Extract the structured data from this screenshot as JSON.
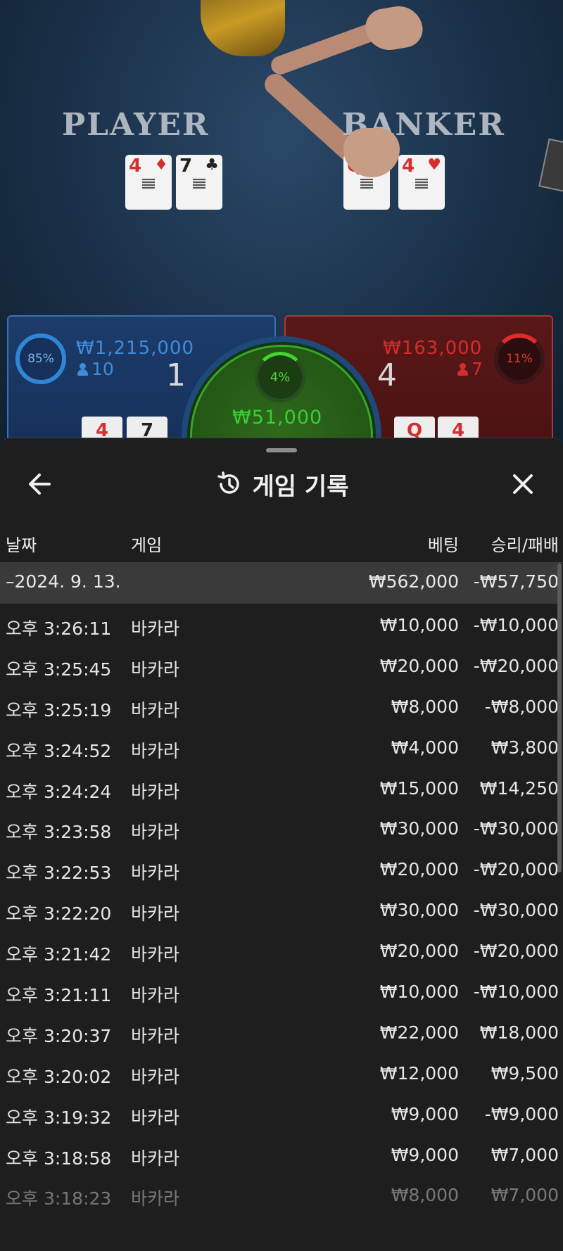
{
  "game": {
    "player_label": "PLAYER",
    "banker_label": "BANKER",
    "player_cards": [
      {
        "rank": "4",
        "suit": "♦"
      },
      {
        "rank": "7",
        "suit": "♣"
      }
    ],
    "banker_cards": [
      {
        "rank": "Q",
        "suit": "♥"
      },
      {
        "rank": "4",
        "suit": "♥"
      }
    ],
    "player": {
      "percent": "85%",
      "amount": "₩1,215,000",
      "count": "10",
      "score": "1"
    },
    "banker": {
      "percent": "11%",
      "amount": "₩163,000",
      "count": "7",
      "score": "4"
    },
    "tie": {
      "percent": "4%",
      "amount": "₩51,000"
    },
    "player_mini_cards": [
      "4",
      "7"
    ],
    "banker_mini_cards": [
      "Q",
      "4"
    ],
    "colors": {
      "player": "#3d8ce0",
      "banker": "#d82b2b",
      "tie": "#37d033"
    }
  },
  "sheet": {
    "title": "게임 기록",
    "back_icon": "arrow-left-icon",
    "history_icon": "history-icon",
    "close_icon": "close-icon",
    "columns": {
      "date": "날짜",
      "game": "게임",
      "bet": "베팅",
      "result": "승리/패배"
    },
    "day": {
      "date": "–2024. 9. 13.",
      "bet": "₩562,000",
      "result": "-₩57,750"
    },
    "rows": [
      {
        "time": "오후 3:26:11",
        "game": "바카라",
        "bet": "₩10,000",
        "result": "-₩10,000"
      },
      {
        "time": "오후 3:25:45",
        "game": "바카라",
        "bet": "₩20,000",
        "result": "-₩20,000"
      },
      {
        "time": "오후 3:25:19",
        "game": "바카라",
        "bet": "₩8,000",
        "result": "-₩8,000"
      },
      {
        "time": "오후 3:24:52",
        "game": "바카라",
        "bet": "₩4,000",
        "result": "₩3,800"
      },
      {
        "time": "오후 3:24:24",
        "game": "바카라",
        "bet": "₩15,000",
        "result": "₩14,250"
      },
      {
        "time": "오후 3:23:58",
        "game": "바카라",
        "bet": "₩30,000",
        "result": "-₩30,000"
      },
      {
        "time": "오후 3:22:53",
        "game": "바카라",
        "bet": "₩20,000",
        "result": "-₩20,000"
      },
      {
        "time": "오후 3:22:20",
        "game": "바카라",
        "bet": "₩30,000",
        "result": "-₩30,000"
      },
      {
        "time": "오후 3:21:42",
        "game": "바카라",
        "bet": "₩20,000",
        "result": "-₩20,000"
      },
      {
        "time": "오후 3:21:11",
        "game": "바카라",
        "bet": "₩10,000",
        "result": "-₩10,000"
      },
      {
        "time": "오후 3:20:37",
        "game": "바카라",
        "bet": "₩22,000",
        "result": "₩18,000"
      },
      {
        "time": "오후 3:20:02",
        "game": "바카라",
        "bet": "₩12,000",
        "result": "₩9,500"
      },
      {
        "time": "오후 3:19:32",
        "game": "바카라",
        "bet": "₩9,000",
        "result": "-₩9,000"
      },
      {
        "time": "오후 3:18:58",
        "game": "바카라",
        "bet": "₩9,000",
        "result": "₩7,000"
      },
      {
        "time": "오후 3:18:23",
        "game": "바카라",
        "bet": "₩8,000",
        "result": "₩7,000"
      }
    ]
  }
}
